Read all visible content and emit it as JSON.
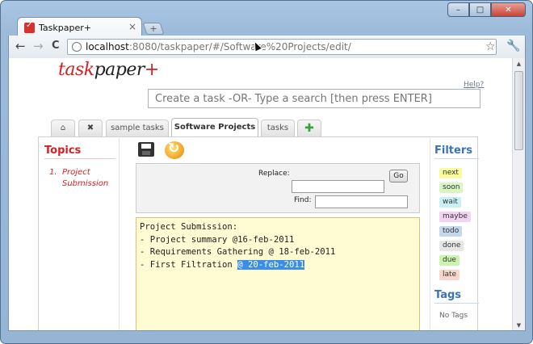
{
  "browser": {
    "tab_title": "Taskpaper+",
    "tab_close": "×",
    "new_tab": "+",
    "window_buttons": {
      "minimize": "–",
      "maximize": "□",
      "close": "✕"
    },
    "nav": {
      "back": "←",
      "forward": "→",
      "reload": "C"
    },
    "url_host": "localhost",
    "url_rest": ":8080/taskpaper/#/Software%20Projects/edit/",
    "star": "☆",
    "wrench": "🔧"
  },
  "app": {
    "logo_part1": "task",
    "logo_part2": "paper",
    "logo_part3": "+",
    "help": "Help?",
    "search_placeholder": "Create a task -OR- Type a search [then press ENTER]",
    "tabs": [
      {
        "label": "⌂"
      },
      {
        "label": "✖"
      },
      {
        "label": "sample tasks"
      },
      {
        "label": "Software Projects"
      },
      {
        "label": "tasks"
      },
      {
        "label": "✚"
      }
    ],
    "topics": {
      "heading": "Topics",
      "items": [
        {
          "num": "1.",
          "line1": "Project",
          "line2": "Submission"
        }
      ]
    },
    "replace": {
      "replace_label": "Replace:",
      "find_label": "Find:",
      "go_label": "Go",
      "replace_value": "",
      "find_value": ""
    },
    "editor": {
      "line1": "Project Submission:",
      "line2": "- Project summary @16-feb-2011",
      "line3": "- Requirements Gathering @ 18-feb-2011",
      "line4_prefix": "- First Filtration ",
      "line4_selected": "@ 20-feb-2011"
    },
    "filters": {
      "heading": "Filters",
      "items": [
        {
          "label": "next",
          "color": "#fafb9c"
        },
        {
          "label": "soon",
          "color": "#d8f5c4"
        },
        {
          "label": "wait",
          "color": "#c9f0f4"
        },
        {
          "label": "maybe",
          "color": "#f2d3f2"
        },
        {
          "label": "todo",
          "color": "#c6d7ec"
        },
        {
          "label": "done",
          "color": "#e6e6e6"
        },
        {
          "label": "due",
          "color": "#cdf3b0"
        },
        {
          "label": "late",
          "color": "#f7d6cc"
        }
      ]
    },
    "tags": {
      "heading": "Tags",
      "empty": "No Tags"
    }
  }
}
